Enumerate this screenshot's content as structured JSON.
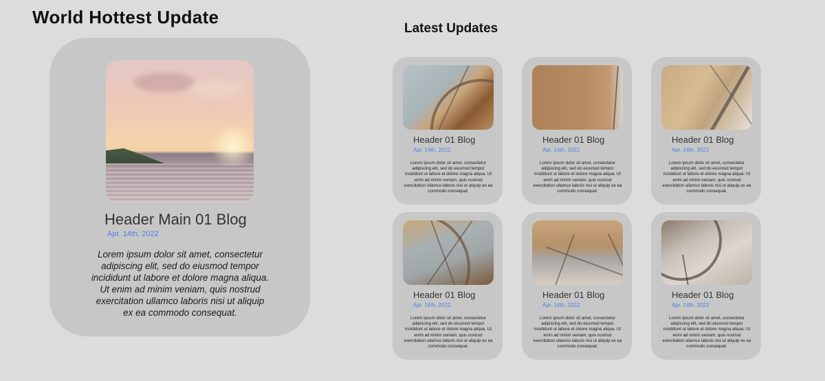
{
  "page_title": "World Hottest Update",
  "latest_title": "Latest Updates",
  "main_post": {
    "title": "Header Main 01 Blog",
    "date": "Apr. 14th, 2022",
    "body": "Lorem ipsum dolor sit amet, consectetur adipiscing elit, sed do eiusmod tempor incididunt ut labore et dolore magna aliqua. Ut enim ad minim veniam, quis nostrud exercitation ullamco laboris nisi ut aliquip ex ea commodo consequat."
  },
  "posts": [
    {
      "title": "Header 01 Blog",
      "date": "Apr. 14th, 2022",
      "body": "Lorem ipsum dolor sit amet, consectetur adipiscing elit, sed do eiusmod tempor incididunt ut labore et dolore magna aliqua. Ut enim ad minim veniam, quis nostrud exercitation ullamco laboris nisi ut aliquip ex ea commodo consequat."
    },
    {
      "title": "Header 01 Blog",
      "date": "Apr. 14th, 2022",
      "body": "Lorem ipsum dolor sit amet, consectetur adipiscing elit, sed do eiusmod tempor incididunt ut labore et dolore magna aliqua. Ut enim ad minim veniam, quis nostrud exercitation ullamco laboris nisi ut aliquip ex ea commodo consequat."
    },
    {
      "title": "Header 01 Blog",
      "date": "Apr. 14th, 2022",
      "body": "Lorem ipsum dolor sit amet, consectetur adipiscing elit, sed do eiusmod tempor incididunt ut labore et dolore magna aliqua. Ut enim ad minim veniam, quis nostrud exercitation ullamco laboris nisi ut aliquip ex ea commodo consequat."
    },
    {
      "title": "Header 01 Blog",
      "date": "Apr. 14th, 2022",
      "body": "Lorem ipsum dolor sit amet, consectetur adipiscing elit, sed do eiusmod tempor incididunt ut labore et dolore magna aliqua. Ut enim ad minim veniam, quis nostrud exercitation ullamco laboris nisi ut aliquip ex ea commodo consequat."
    },
    {
      "title": "Header 01 Blog",
      "date": "Apr. 14th, 2022",
      "body": "Lorem ipsum dolor sit amet, consectetur adipiscing elit, sed do eiusmod tempor incididunt ut labore et dolore magna aliqua. Ut enim ad minim veniam, quis nostrud exercitation ullamco laboris nisi ut aliquip ex ea commodo consequat."
    },
    {
      "title": "Header 01 Blog",
      "date": "Apr. 14th, 2022",
      "body": "Lorem ipsum dolor sit amet, consectetur adipiscing elit, sed do eiusmod tempor incididunt ut labore et dolore magna aliqua. Ut enim ad minim veniam, quis nostrud exercitation ullamco laboris nisi ut aliquip ex ea commodo consequat."
    }
  ],
  "colors": {
    "background": "#dcdcdc",
    "card": "#c7c7c7",
    "date_accent": "#4a7fe6"
  }
}
